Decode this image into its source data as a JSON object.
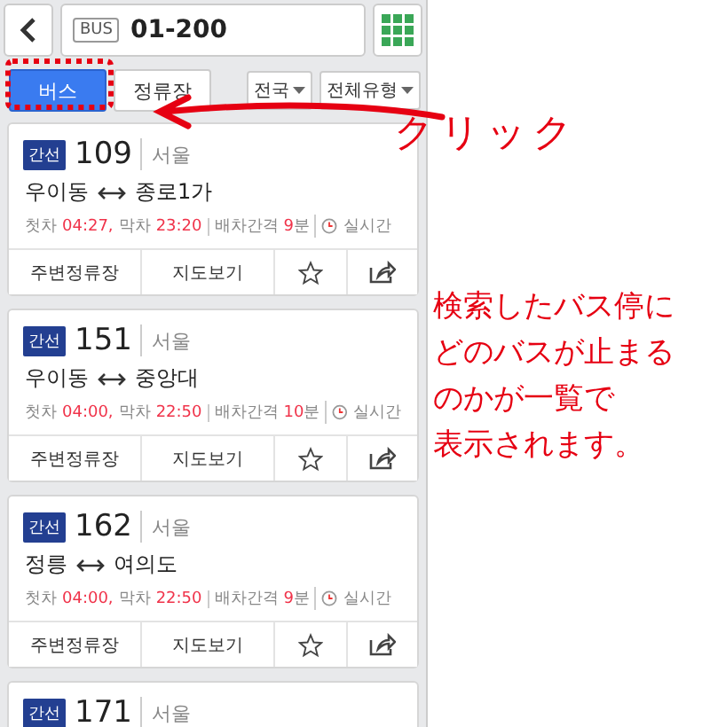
{
  "search": {
    "badge": "BUS",
    "value": "01-200"
  },
  "tabs": [
    {
      "label": "버스",
      "selected": true
    },
    {
      "label": "정류장",
      "selected": false
    }
  ],
  "filters": [
    {
      "label": "전국"
    },
    {
      "label": "전체유형"
    }
  ],
  "routes": [
    {
      "tag": "간선",
      "number": "109",
      "region": "서울",
      "from": "우이동",
      "to": "종로1가",
      "first_label": "첫차",
      "first": "04:27,",
      "last_label": "막차",
      "last": "23:20",
      "interval_label": "배차간격",
      "interval": "9",
      "interval_unit": "분",
      "realtime": "실시간",
      "actions": [
        "주변정류장",
        "지도보기"
      ]
    },
    {
      "tag": "간선",
      "number": "151",
      "region": "서울",
      "from": "우이동",
      "to": "중앙대",
      "first_label": "첫차",
      "first": "04:00,",
      "last_label": "막차",
      "last": "22:50",
      "interval_label": "배차간격",
      "interval": "10",
      "interval_unit": "분",
      "realtime": "실시간",
      "actions": [
        "주변정류장",
        "지도보기"
      ]
    },
    {
      "tag": "간선",
      "number": "162",
      "region": "서울",
      "from": "정릉",
      "to": "여의도",
      "first_label": "첫차",
      "first": "04:00,",
      "last_label": "막차",
      "last": "22:50",
      "interval_label": "배차간격",
      "interval": "9",
      "interval_unit": "분",
      "realtime": "실시간",
      "actions": [
        "주변정류장",
        "지도보기"
      ]
    },
    {
      "tag": "간선",
      "number": "171",
      "region": "서울"
    }
  ],
  "annotations": {
    "click_label": "クリック",
    "note_lines": [
      "検索したバス停に",
      "どのバスが止まる",
      "のかが一覧で",
      "表示されます。"
    ]
  }
}
